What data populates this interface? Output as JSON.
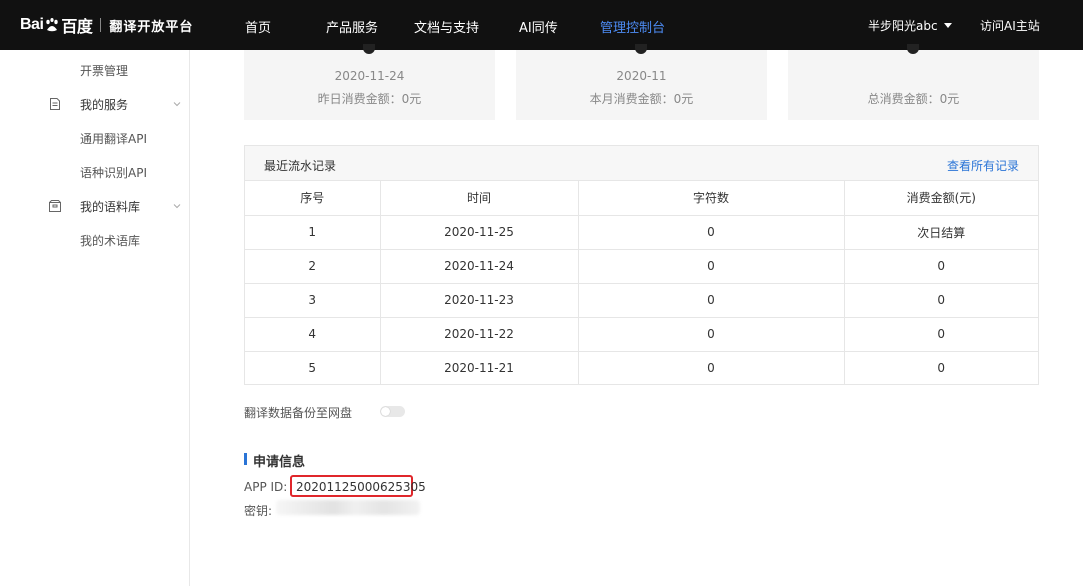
{
  "header": {
    "logo_brand": "Bai百度",
    "logo_title": "翻译开放平台",
    "nav": [
      "首页",
      "产品服务",
      "文档与支持",
      "AI同传",
      "管理控制台"
    ],
    "active_nav": "管理控制台",
    "user": "半步阳光abc",
    "visit_link": "访问AI主站"
  },
  "sidebar": {
    "sub_invoice": "开票管理",
    "group_services": "我的服务",
    "sub_general_api": "通用翻译API",
    "sub_lang_api": "语种识别API",
    "group_corpus": "我的语料库",
    "sub_terms": "我的术语库"
  },
  "stats": [
    {
      "date": "2020-11-24",
      "label": "昨日消费金额：0元"
    },
    {
      "date": "2020-11",
      "label": "本月消费金额：0元"
    },
    {
      "date": "",
      "label": "总消费金额：0元"
    }
  ],
  "records": {
    "title": "最近流水记录",
    "view_all": "查看所有记录",
    "columns": [
      "序号",
      "时间",
      "字符数",
      "消费金额(元)"
    ],
    "rows": [
      [
        "1",
        "2020-11-25",
        "0",
        "次日结算"
      ],
      [
        "2",
        "2020-11-24",
        "0",
        "0"
      ],
      [
        "3",
        "2020-11-23",
        "0",
        "0"
      ],
      [
        "4",
        "2020-11-22",
        "0",
        "0"
      ],
      [
        "5",
        "2020-11-21",
        "0",
        "0"
      ]
    ]
  },
  "backup": {
    "label": "翻译数据备份至网盘",
    "enabled": false
  },
  "application": {
    "title": "申请信息",
    "app_id_label": "APP ID:",
    "app_id": "20201125000625305",
    "key_label": "密钥:"
  },
  "colors": {
    "accent": "#2a74d6",
    "highlight_border": "#e0262b",
    "topbar": "#111111"
  }
}
